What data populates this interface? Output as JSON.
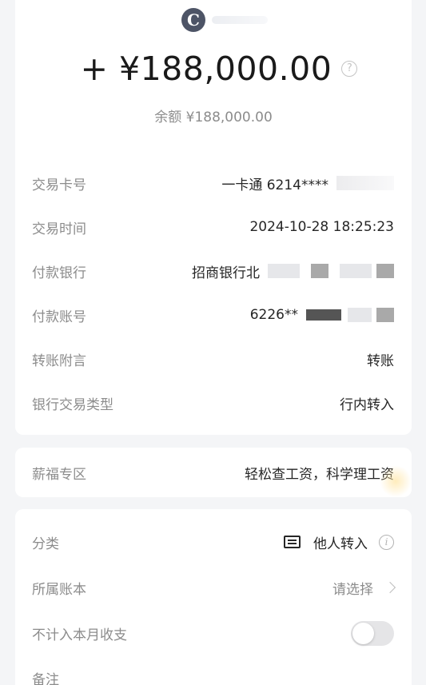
{
  "header": {
    "bank_logo_glyph": "C",
    "amount": "+ ¥188,000.00",
    "help_glyph": "?",
    "balance": "余额 ¥188,000.00"
  },
  "details": [
    {
      "label": "交易卡号",
      "value": "一卡通 6214****"
    },
    {
      "label": "交易时间",
      "value": "2024-10-28 18:25:23"
    },
    {
      "label": "付款银行",
      "value": "招商银行北"
    },
    {
      "label": "付款账号",
      "value": "6226**"
    },
    {
      "label": "转账附言",
      "value": "转账"
    },
    {
      "label": "银行交易类型",
      "value": "行内转入"
    }
  ],
  "salary": {
    "label": "薪福专区",
    "value": "轻松查工资，科学理工资"
  },
  "settings": {
    "category_label": "分类",
    "category_value": "他人转入",
    "info_glyph": "i",
    "ledger_label": "所属账本",
    "ledger_placeholder": "请选择",
    "exclude_label": "不计入本月收支",
    "exclude_enabled": false,
    "note_label": "备注"
  },
  "colors": {
    "background": "#f4f5f7",
    "card": "#ffffff",
    "label": "#8c8c8c",
    "value": "#262626",
    "logo": "#4d5466"
  }
}
